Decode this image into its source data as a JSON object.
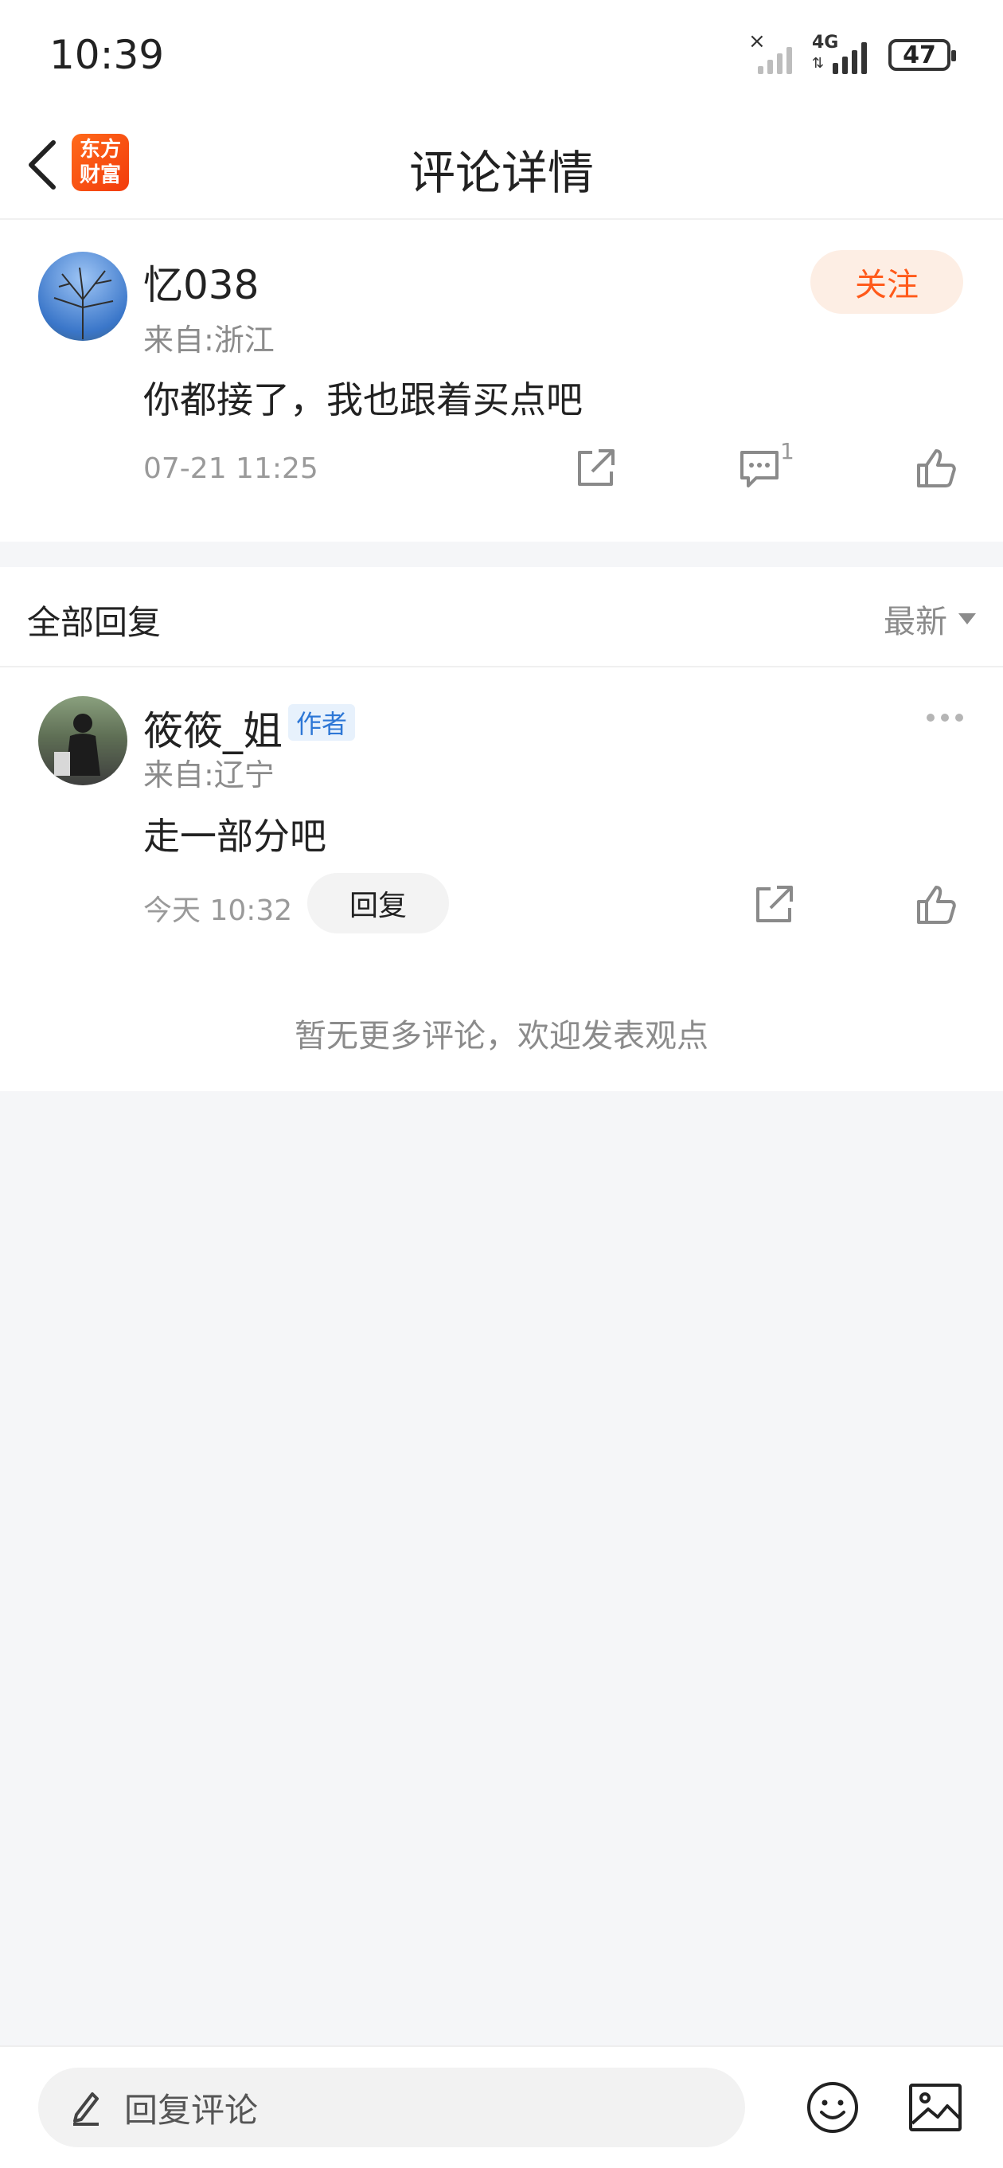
{
  "status_bar": {
    "time": "10:39",
    "network": "4G",
    "battery": "47"
  },
  "nav": {
    "title": "评论详情",
    "logo_line1": "东方",
    "logo_line2": "财富"
  },
  "main_comment": {
    "username": "忆038",
    "location": "来自:浙江",
    "content": "你都接了，我也跟着买点吧",
    "time": "07-21 11:25",
    "follow_label": "关注",
    "reply_count": "1"
  },
  "replies": {
    "title": "全部回复",
    "sort_label": "最新",
    "items": [
      {
        "username": "筱筱_姐",
        "badge": "作者",
        "location": "来自:辽宁",
        "content": "走一部分吧",
        "time": "今天 10:32",
        "reply_label": "回复"
      }
    ],
    "no_more_text": "暂无更多评论，欢迎发表观点"
  },
  "composer": {
    "placeholder": "回复评论"
  },
  "colors": {
    "accent": "#ff5a1a",
    "badge_blue": "#2d77d6",
    "background": "#f5f6f8"
  },
  "icons": {
    "back": "chevron-left-icon",
    "share": "share-external-icon",
    "comment": "comment-bubble-icon",
    "like": "thumbs-up-icon",
    "more": "more-dots-icon",
    "edit": "pencil-icon",
    "emoji": "emoji-smile-icon",
    "image": "image-icon"
  }
}
